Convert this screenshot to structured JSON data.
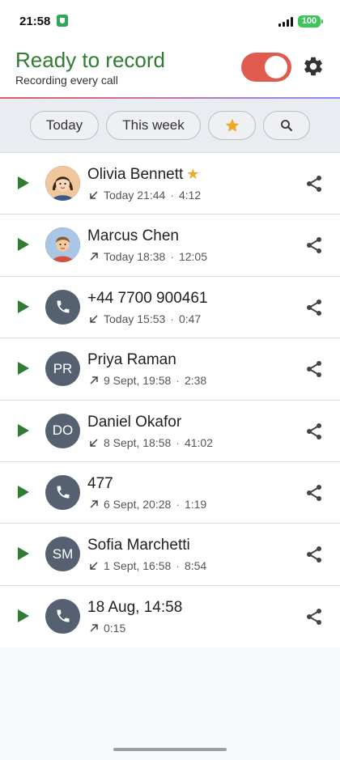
{
  "status_bar": {
    "time": "21:58",
    "battery": "100"
  },
  "header": {
    "title": "Ready to record",
    "subtitle": "Recording every call",
    "recording_enabled": true
  },
  "filters": {
    "today": "Today",
    "this_week": "This week",
    "starred_icon": "star-icon",
    "search_icon": "search-icon"
  },
  "calls": [
    {
      "name": "Olivia Bennett",
      "starred": true,
      "avatar": "photo-woman",
      "direction": "incoming",
      "when": "Today 21:44",
      "duration": "4:12"
    },
    {
      "name": "Marcus Chen",
      "starred": false,
      "avatar": "photo-man",
      "direction": "outgoing",
      "when": "Today 18:38",
      "duration": "12:05"
    },
    {
      "name": "+44 7700 900461",
      "starred": false,
      "avatar": "phone-icon",
      "direction": "incoming",
      "when": "Today 15:53",
      "duration": "0:47"
    },
    {
      "name": "Priya Raman",
      "starred": false,
      "avatar": "PR",
      "direction": "outgoing",
      "when": "9 Sept, 19:58",
      "duration": "2:38"
    },
    {
      "name": "Daniel Okafor",
      "starred": false,
      "avatar": "DO",
      "direction": "incoming",
      "when": "8 Sept, 18:58",
      "duration": "41:02"
    },
    {
      "name": "477",
      "starred": false,
      "avatar": "phone-icon",
      "direction": "outgoing",
      "when": "6 Sept, 20:28",
      "duration": "1:19"
    },
    {
      "name": "Sofia Marchetti",
      "starred": false,
      "avatar": "SM",
      "direction": "incoming",
      "when": "1 Sept, 16:58",
      "duration": "8:54"
    },
    {
      "name": "18 Aug, 14:58",
      "starred": false,
      "avatar": "phone-icon",
      "direction": "outgoing",
      "when": "",
      "duration": "0:15"
    }
  ],
  "colors": {
    "accent_green": "#2e7d32",
    "toggle_red": "#e05a4d",
    "star_gold": "#f0a828",
    "avatar_grey": "#556070"
  }
}
